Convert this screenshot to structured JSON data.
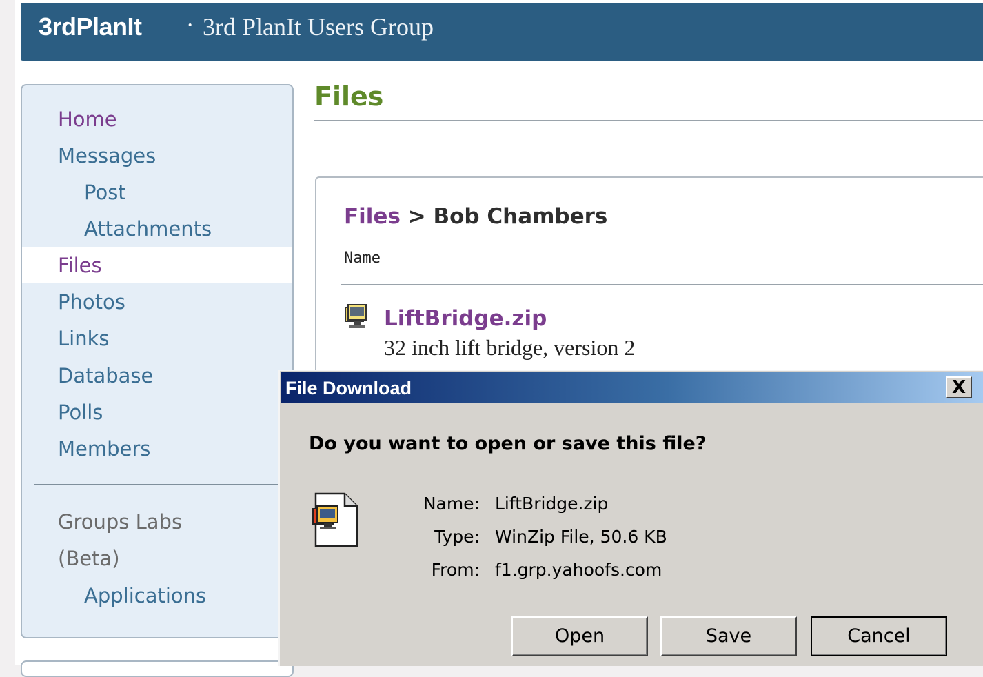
{
  "header": {
    "brand": "3rdPlanIt",
    "separator": "·",
    "group_name": "3rd PlanIt Users Group"
  },
  "sidebar": {
    "items": [
      {
        "label": "Home"
      },
      {
        "label": "Messages"
      },
      {
        "label": "Post"
      },
      {
        "label": "Attachments"
      },
      {
        "label": "Files"
      },
      {
        "label": "Photos"
      },
      {
        "label": "Links"
      },
      {
        "label": "Database"
      },
      {
        "label": "Polls"
      },
      {
        "label": "Members"
      }
    ],
    "labs": {
      "title_line1": "Groups Labs",
      "title_line2": "(Beta)",
      "applications": "Applications"
    }
  },
  "main": {
    "title": "Files",
    "breadcrumb": {
      "root": "Files",
      "separator": ">",
      "current": "Bob Chambers"
    },
    "column_name": "Name",
    "file": {
      "name": "LiftBridge.zip",
      "description": "32 inch lift bridge, version 2"
    }
  },
  "dialog": {
    "title": "File Download",
    "close_label": "X",
    "question": "Do you want to open or save this file?",
    "name_label": "Name:",
    "name_value": "LiftBridge.zip",
    "type_label": "Type:",
    "type_value": "WinZip File, 50.6 KB",
    "from_label": "From:",
    "from_value": "f1.grp.yahoofs.com",
    "buttons": {
      "open": "Open",
      "save": "Save",
      "cancel": "Cancel"
    }
  },
  "colors": {
    "header_bg": "#2b5d82",
    "sidebar_bg": "#e5eef7",
    "link_purple": "#7b3d8e",
    "nav_blue": "#3a6e93",
    "title_green": "#5f8a2a",
    "dialog_bg": "#d6d3ce",
    "titlebar_start": "#0a246a"
  },
  "icons": {
    "file": "winzip-file-icon",
    "dialog_file": "zip-document-icon",
    "close": "close-icon"
  }
}
